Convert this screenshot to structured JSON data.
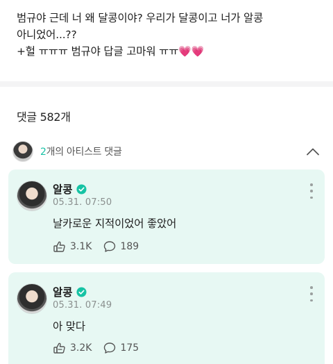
{
  "post": {
    "lines": [
      "범규야 근데 너 왜 달콩이야?  우리가 달콩이고 너가 알콩",
      "아니었어...??",
      "+헐 ㅠㅠㅠ 범규야 답글 고마워 ㅠㅠ"
    ],
    "hearts": "💗💗"
  },
  "comments_header": {
    "label": "댓글 582개"
  },
  "artist_comments": {
    "count": "2",
    "suffix": "개의 아티스트 댓글"
  },
  "comments": [
    {
      "name": "알콩",
      "time": "05.31. 07:50",
      "text": "날카로운 지적이었어 좋았어",
      "likes": "3.1K",
      "replies": "189"
    },
    {
      "name": "알콩",
      "time": "05.31. 07:49",
      "text": "아 맞다",
      "likes": "3.2K",
      "replies": "175"
    }
  ],
  "colors": {
    "accent": "#19c2a6",
    "card_bg": "#e7f8f3",
    "verified": "#16c3a4"
  }
}
